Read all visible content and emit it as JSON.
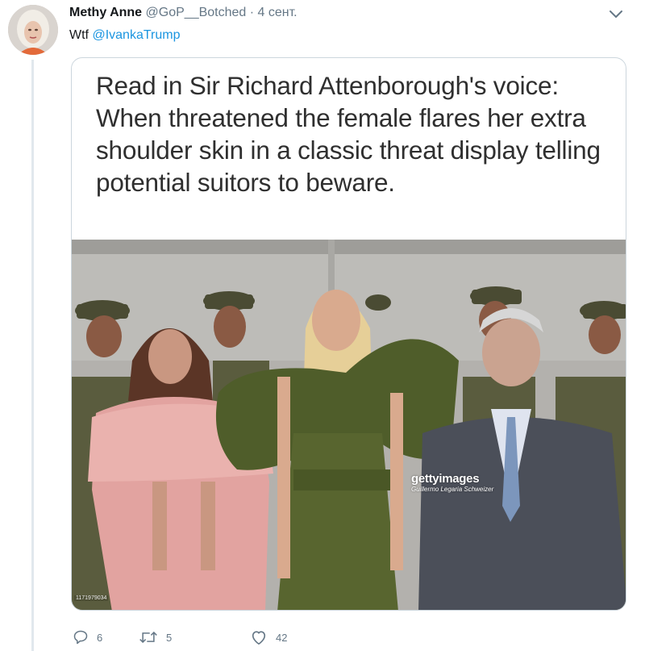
{
  "tweet": {
    "author": {
      "display_name": "Methy Anne",
      "handle": "@GoP__Botched",
      "separator": "·",
      "time": "4 сент."
    },
    "text_prefix": "Wtf",
    "mention": "@IvankaTrump",
    "media": {
      "caption": "Read in Sir Richard Attenborough's voice: When threatened the female flares her extra shoulder skin in a classic threat display telling potential suitors to beware.",
      "watermark_logo": "gettyimages",
      "watermark_credit": "Guillermo Legaria Schweizer",
      "image_id": "1171979034"
    },
    "actions": {
      "reply_count": "6",
      "retweet_count": "5",
      "like_count": "42"
    }
  },
  "icons": {
    "reply": "reply-icon",
    "retweet": "retweet-icon",
    "like": "heart-icon",
    "more": "chevron-down-icon"
  },
  "colors": {
    "link": "#1b95e0",
    "secondary_text": "#657786",
    "card_border": "#ccd6dd",
    "thread_line": "#e1e8ed"
  }
}
